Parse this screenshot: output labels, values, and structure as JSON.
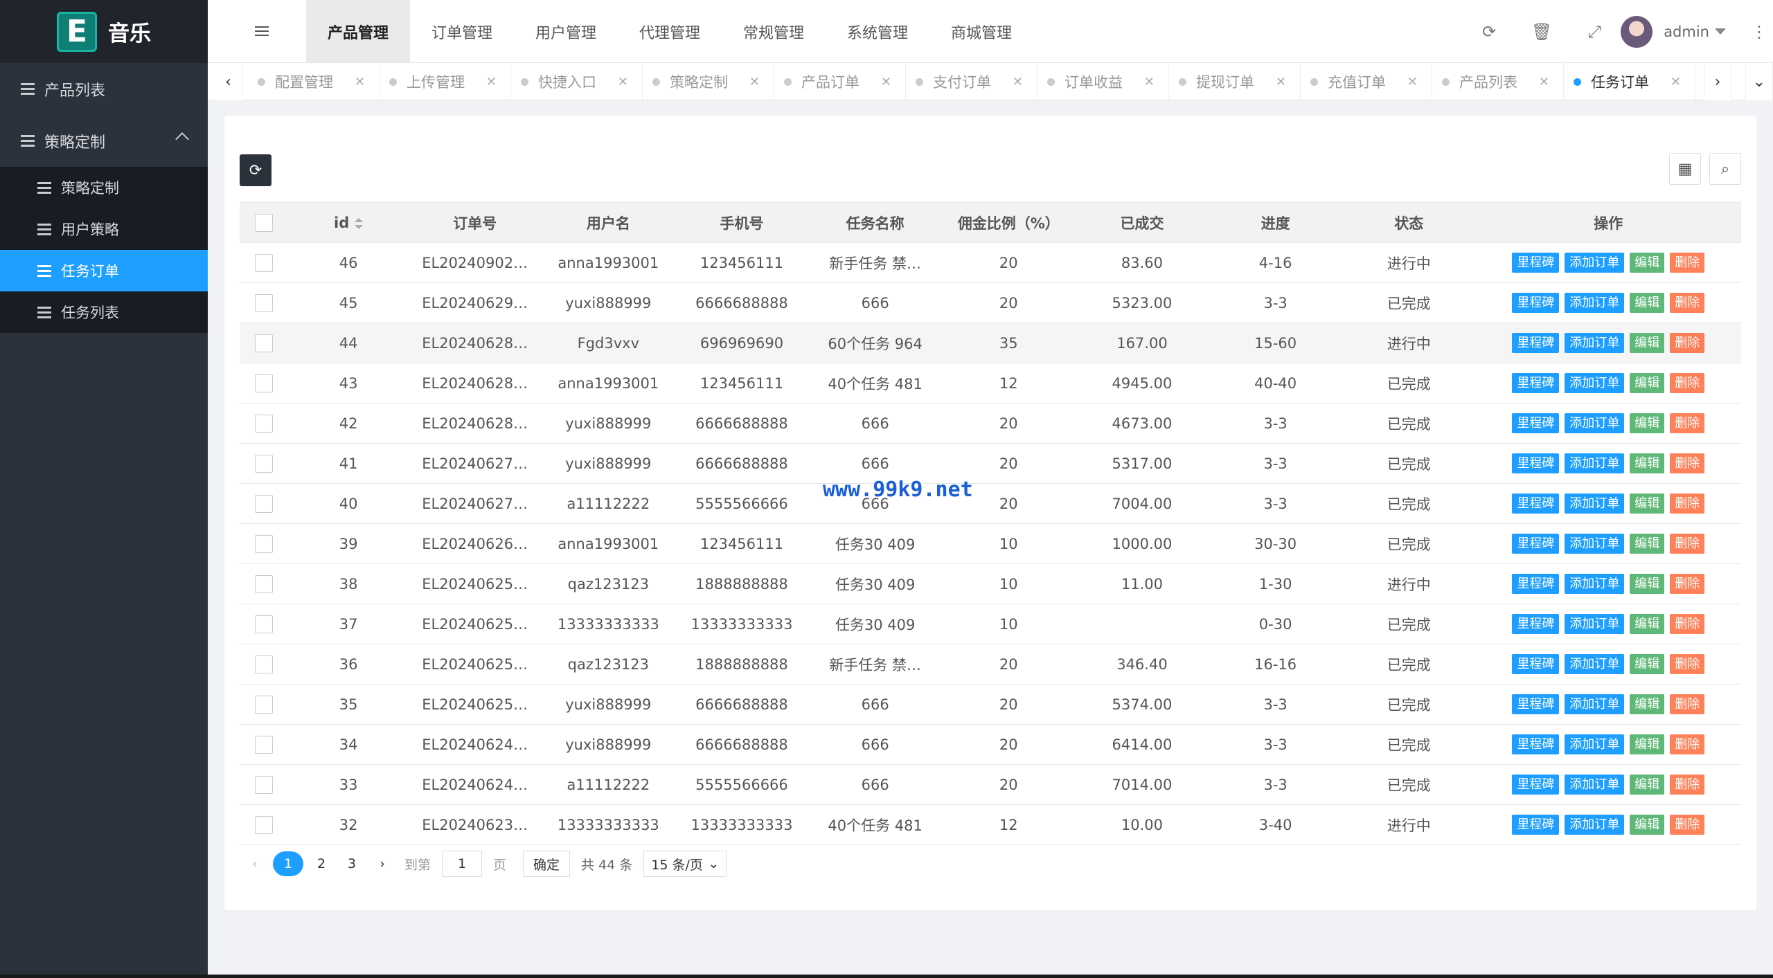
{
  "logo": {
    "letter": "E",
    "name": "音乐"
  },
  "sidebar": {
    "items": [
      {
        "label": "产品列表"
      },
      {
        "label": "策略定制"
      }
    ],
    "submenu": [
      {
        "label": "策略定制"
      },
      {
        "label": "用户策略"
      },
      {
        "label": "任务订单",
        "active": true
      },
      {
        "label": "任务列表"
      }
    ]
  },
  "header": {
    "nav": [
      "产品管理",
      "订单管理",
      "用户管理",
      "代理管理",
      "常规管理",
      "系统管理",
      "商城管理"
    ],
    "user": "admin"
  },
  "tabs": [
    "配置管理",
    "上传管理",
    "快捷入口",
    "策略定制",
    "产品订单",
    "支付订单",
    "订单收益",
    "提现订单",
    "充值订单",
    "产品列表",
    "任务订单"
  ],
  "table": {
    "headers": [
      "id",
      "订单号",
      "用户名",
      "手机号",
      "任务名称",
      "佣金比例（%）",
      "已成交",
      "进度",
      "状态",
      "操作"
    ],
    "actions": [
      "里程碑",
      "添加订单",
      "编辑",
      "删除"
    ],
    "rows": [
      [
        "46",
        "EL20240902…",
        "anna1993001",
        "123456111",
        "新手任务 禁…",
        "20",
        "83.60",
        "4-16",
        "进行中"
      ],
      [
        "45",
        "EL20240629…",
        "yuxi888999",
        "6666688888",
        "666",
        "20",
        "5323.00",
        "3-3",
        "已完成"
      ],
      [
        "44",
        "EL20240628…",
        "Fgd3vxv",
        "696969690",
        "60个任务 964",
        "35",
        "167.00",
        "15-60",
        "进行中"
      ],
      [
        "43",
        "EL20240628…",
        "anna1993001",
        "123456111",
        "40个任务 481",
        "12",
        "4945.00",
        "40-40",
        "已完成"
      ],
      [
        "42",
        "EL20240628…",
        "yuxi888999",
        "6666688888",
        "666",
        "20",
        "4673.00",
        "3-3",
        "已完成"
      ],
      [
        "41",
        "EL20240627…",
        "yuxi888999",
        "6666688888",
        "666",
        "20",
        "5317.00",
        "3-3",
        "已完成"
      ],
      [
        "40",
        "EL20240627…",
        "a11112222",
        "5555566666",
        "666",
        "20",
        "7004.00",
        "3-3",
        "已完成"
      ],
      [
        "39",
        "EL20240626…",
        "anna1993001",
        "123456111",
        "任务30 409",
        "10",
        "1000.00",
        "30-30",
        "已完成"
      ],
      [
        "38",
        "EL20240625…",
        "qaz123123",
        "1888888888",
        "任务30 409",
        "10",
        "11.00",
        "1-30",
        "进行中"
      ],
      [
        "37",
        "EL20240625…",
        "13333333333",
        "13333333333",
        "任务30 409",
        "10",
        "",
        "0-30",
        "已完成"
      ],
      [
        "36",
        "EL20240625…",
        "qaz123123",
        "1888888888",
        "新手任务 禁…",
        "20",
        "346.40",
        "16-16",
        "已完成"
      ],
      [
        "35",
        "EL20240625…",
        "yuxi888999",
        "6666688888",
        "666",
        "20",
        "5374.00",
        "3-3",
        "已完成"
      ],
      [
        "34",
        "EL20240624…",
        "yuxi888999",
        "6666688888",
        "666",
        "20",
        "6414.00",
        "3-3",
        "已完成"
      ],
      [
        "33",
        "EL20240624…",
        "a11112222",
        "5555566666",
        "666",
        "20",
        "7014.00",
        "3-3",
        "已完成"
      ],
      [
        "32",
        "EL20240623…",
        "13333333333",
        "13333333333",
        "40个任务 481",
        "12",
        "10.00",
        "3-40",
        "进行中"
      ]
    ]
  },
  "pager": {
    "pages": [
      "1",
      "2",
      "3"
    ],
    "goto_label": "到第",
    "page_value": "1",
    "page_suffix": "页",
    "confirm": "确定",
    "total": "共 44 条",
    "per_page": "15 条/页"
  },
  "watermark": "www.99k9.net"
}
